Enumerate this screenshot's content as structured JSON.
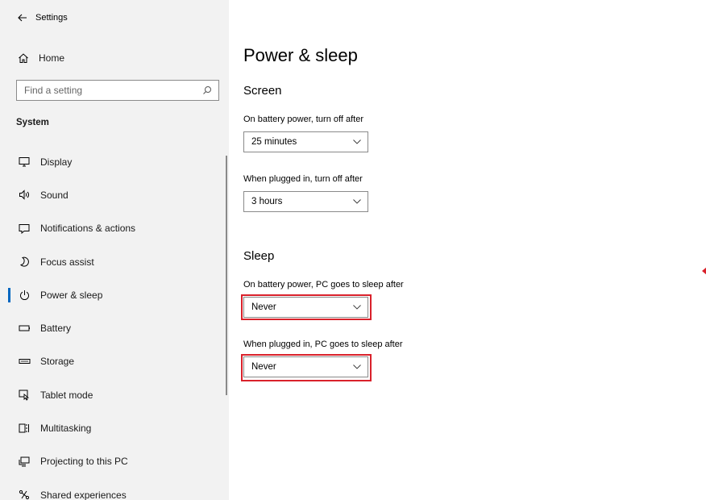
{
  "window": {
    "title": "Settings"
  },
  "sidebar": {
    "home_label": "Home",
    "search_placeholder": "Find a setting",
    "section": "System",
    "items": [
      {
        "label": "Display",
        "icon": "display-icon"
      },
      {
        "label": "Sound",
        "icon": "sound-icon"
      },
      {
        "label": "Notifications & actions",
        "icon": "notifications-icon"
      },
      {
        "label": "Focus assist",
        "icon": "moon-icon"
      },
      {
        "label": "Power & sleep",
        "icon": "power-icon",
        "active": true
      },
      {
        "label": "Battery",
        "icon": "battery-icon"
      },
      {
        "label": "Storage",
        "icon": "storage-icon"
      },
      {
        "label": "Tablet mode",
        "icon": "tablet-mode-icon"
      },
      {
        "label": "Multitasking",
        "icon": "multitasking-icon"
      },
      {
        "label": "Projecting to this PC",
        "icon": "projecting-icon"
      },
      {
        "label": "Shared experiences",
        "icon": "shared-experiences-icon"
      }
    ]
  },
  "main": {
    "title": "Power & sleep",
    "screen": {
      "heading": "Screen",
      "battery_label": "On battery power, turn off after",
      "battery_value": "25 minutes",
      "plugged_label": "When plugged in, turn off after",
      "plugged_value": "3 hours"
    },
    "sleep": {
      "heading": "Sleep",
      "battery_label": "On battery power, PC goes to sleep after",
      "battery_value": "Never",
      "plugged_label": "When plugged in, PC goes to sleep after",
      "plugged_value": "Never"
    }
  },
  "colors": {
    "sidebar_bg": "#f2f2f2",
    "accent": "#0067c0",
    "highlight": "#d9212b"
  }
}
